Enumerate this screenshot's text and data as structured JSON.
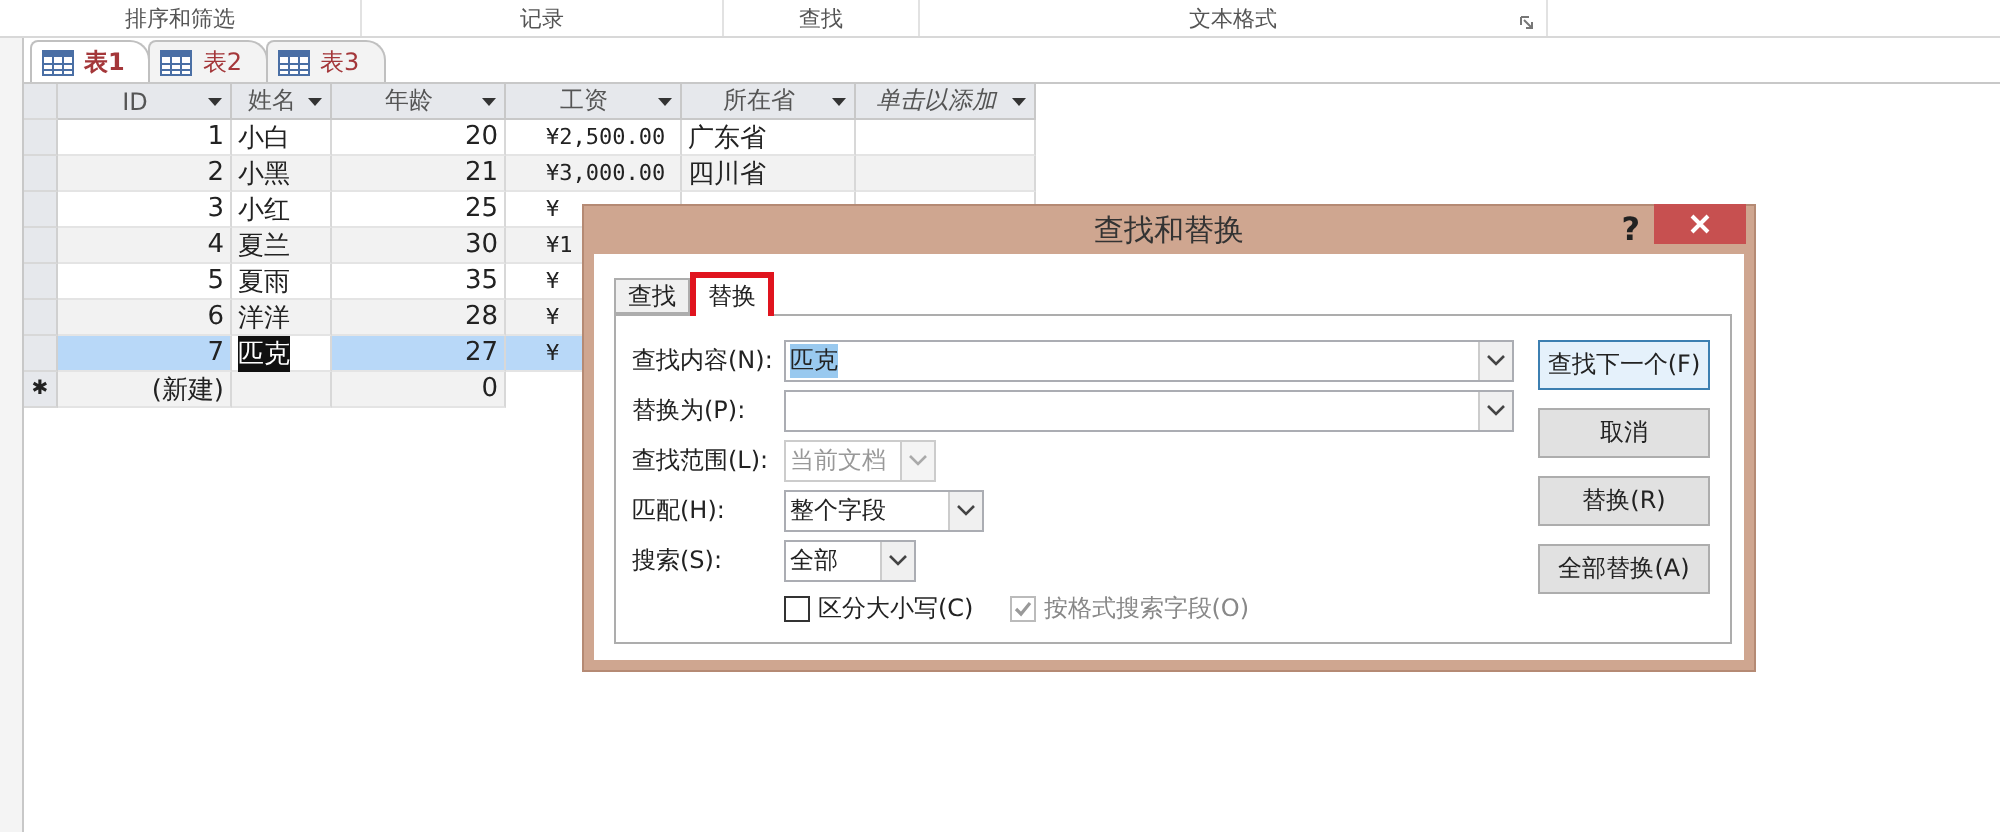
{
  "ribbon_groups": [
    {
      "label": "排序和筛选",
      "launcher": false
    },
    {
      "label": "记录",
      "launcher": false
    },
    {
      "label": "查找",
      "launcher": false
    },
    {
      "label": "文本格式",
      "launcher": true
    }
  ],
  "document_tabs": [
    {
      "label": "表1",
      "selected": true
    },
    {
      "label": "表2",
      "selected": false
    },
    {
      "label": "表3",
      "selected": false
    }
  ],
  "table": {
    "columns": [
      {
        "label": "ID",
        "italic": false
      },
      {
        "label": "姓名",
        "italic": false
      },
      {
        "label": "年龄",
        "italic": false
      },
      {
        "label": "工资",
        "italic": false
      },
      {
        "label": "所在省",
        "italic": false
      },
      {
        "label": "单击以添加",
        "italic": true
      }
    ],
    "rows": [
      {
        "cells": [
          "1",
          "小白",
          "20",
          "¥2,500.00",
          "广东省",
          ""
        ],
        "selected": false
      },
      {
        "cells": [
          "2",
          "小黑",
          "21",
          "¥3,000.00",
          "四川省",
          ""
        ],
        "selected": false
      },
      {
        "cells": [
          "3",
          "小红",
          "25",
          "¥",
          "",
          ""
        ],
        "selected": false
      },
      {
        "cells": [
          "4",
          "夏兰",
          "30",
          "¥1"
        ],
        "selected": false
      },
      {
        "cells": [
          "5",
          "夏雨",
          "35",
          "¥"
        ],
        "selected": false
      },
      {
        "cells": [
          "6",
          "洋洋",
          "28",
          "¥"
        ],
        "selected": false
      },
      {
        "cells": [
          "7",
          "匹克",
          "27",
          "¥"
        ],
        "selected": true
      }
    ],
    "new_row": {
      "marker": "✱",
      "cells": [
        "(新建)",
        "",
        "0"
      ]
    }
  },
  "dialog": {
    "title": "查找和替换",
    "help": "?",
    "tabs": [
      {
        "label": "查找",
        "selected": false,
        "highlighted": false
      },
      {
        "label": "替换",
        "selected": true,
        "highlighted": true
      }
    ],
    "fields": [
      {
        "label": "查找内容(N):",
        "value": "匹克",
        "kind": "combo",
        "selected_text": true,
        "disabled": false
      },
      {
        "label": "替换为(P):",
        "kind": "combo",
        "disabled": false
      },
      {
        "label": "查找范围(L):",
        "value": "当前文档",
        "kind": "short",
        "disabled": true
      },
      {
        "label": "匹配(H):",
        "value": "整个字段",
        "kind": "medium",
        "disabled": false
      },
      {
        "label": "搜索(S):",
        "value": "全部",
        "kind": "small",
        "disabled": false
      }
    ],
    "checkboxes": [
      {
        "label": "区分大小写(C)",
        "checked": false,
        "disabled": false
      },
      {
        "label": "按格式搜索字段(O)",
        "checked": true,
        "disabled": true
      }
    ],
    "buttons": [
      {
        "label": "查找下一个(F)",
        "default": true
      },
      {
        "label": "取消",
        "default": false
      },
      {
        "label": "替换(R)",
        "default": false
      },
      {
        "label": "全部替换(A)",
        "default": false
      }
    ]
  }
}
